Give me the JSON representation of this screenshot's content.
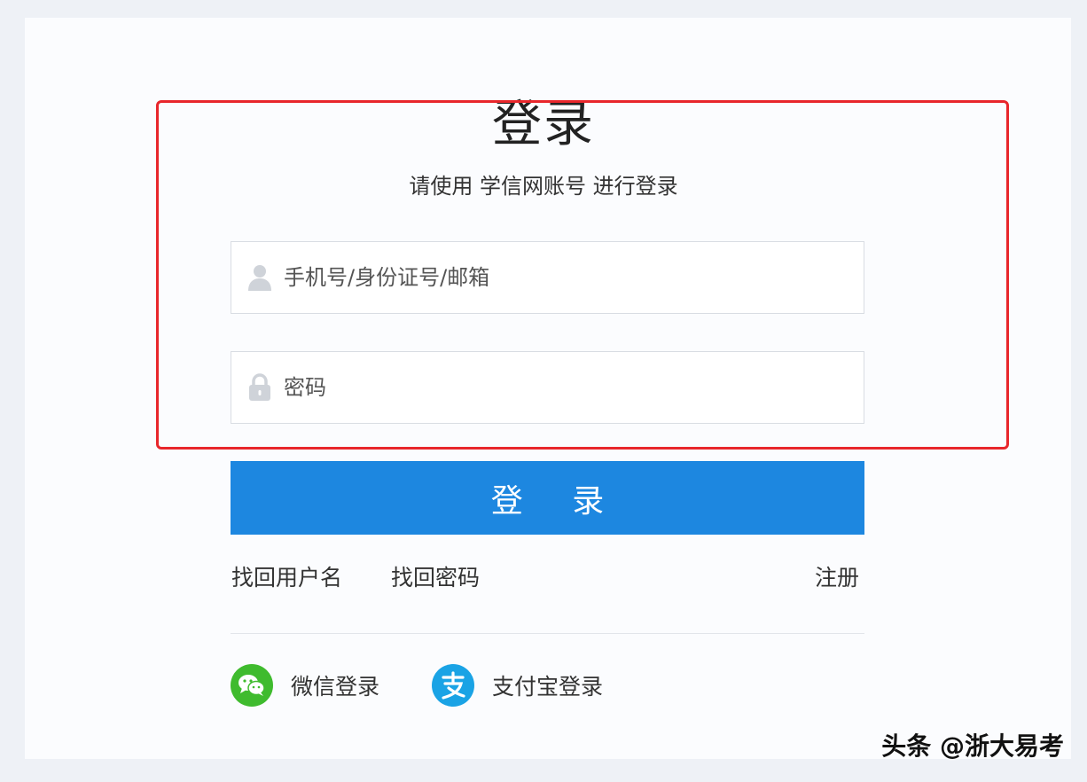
{
  "login": {
    "title": "登录",
    "subtitle": "请使用 学信网账号 进行登录",
    "username_placeholder": "手机号/身份证号/邮箱",
    "password_placeholder": "密码",
    "submit_label": "登 录"
  },
  "links": {
    "find_username": "找回用户名",
    "find_password": "找回密码",
    "register": "注册"
  },
  "social": {
    "wechat_label": "微信登录",
    "alipay_label": "支付宝登录"
  },
  "watermark": "头条 @浙大易考",
  "icons": {
    "username": "user-icon",
    "password": "lock-icon",
    "wechat": "wechat-icon",
    "alipay": "alipay-icon"
  },
  "colors": {
    "primary_button": "#1d87e0",
    "highlight_border": "#e8262b",
    "wechat_green": "#3fbb2e",
    "alipay_blue": "#1aa3e5"
  }
}
